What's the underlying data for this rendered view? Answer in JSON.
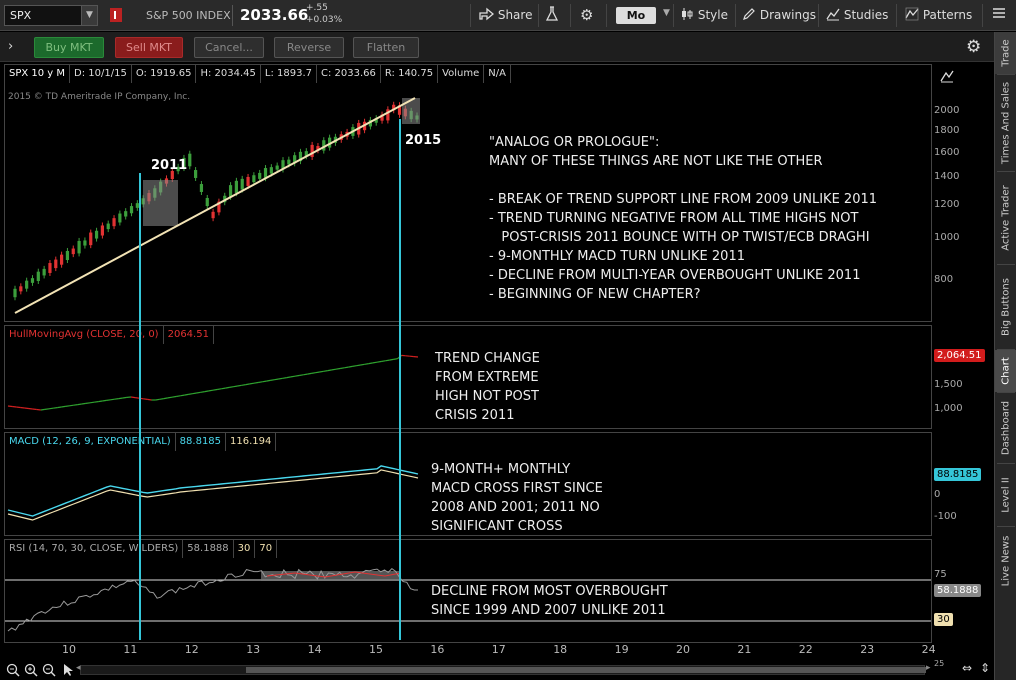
{
  "topbar": {
    "symbol": "SPX",
    "index_name": "S&P 500 INDEX",
    "last_price": "2033.66",
    "change_abs": "+.55",
    "change_pct": "+0.03%",
    "share": "Share",
    "mode": "Mo",
    "style": "Style",
    "drawings": "Drawings",
    "studies": "Studies",
    "patterns": "Patterns"
  },
  "order_bar": {
    "buy": "Buy MKT",
    "sell": "Sell MKT",
    "cancel": "Cancel...",
    "reverse": "Reverse",
    "flatten": "Flatten"
  },
  "side_tabs": [
    "Trade",
    "Times And Sales",
    "Active Trader",
    "Big Buttons",
    "Chart",
    "Dashboard",
    "Level II",
    "Live News"
  ],
  "price_pane": {
    "header": {
      "period": "SPX 10 y M",
      "date": "D: 10/1/15",
      "open": "O: 1919.65",
      "high": "H: 2034.45",
      "low": "L: 1893.7",
      "close": "C: 2033.66",
      "range": "R: 140.75",
      "volume_label": "Volume",
      "volume_value": "N/A"
    },
    "copyright": "2015 © TD Ameritrade IP Company, Inc.",
    "label_2011": "2011",
    "label_2015": "2015",
    "annotation": "\"ANALOG OR PROLOGUE\":\nMANY OF THESE THINGS ARE NOT LIKE THE OTHER\n\n- BREAK OF TREND SUPPORT LINE FROM 2009 UNLIKE 2011\n- TREND TURNING NEGATIVE FROM ALL TIME HIGHS NOT\n   POST-CRISIS 2011 BOUNCE WITH OP TWIST/ECB DRAGHI\n- 9-MONTHLY MACD TURN UNLIKE 2011\n- DECLINE FROM MULTI-YEAR OVERBOUGHT UNLIKE 2011\n- BEGINNING OF NEW CHAPTER?",
    "scale": [
      "2000",
      "1800",
      "1600",
      "1400",
      "1200",
      "1000",
      "800"
    ]
  },
  "hull_pane": {
    "study": "HullMovingAvg (CLOSE, 20, 0)",
    "value": "2064.51",
    "tag": "2,064.51",
    "annotation": "TREND CHANGE\nFROM EXTREME\nHIGH NOT POST\nCRISIS 2011",
    "scale": [
      "2,000",
      "1,500",
      "1,000"
    ]
  },
  "macd_pane": {
    "study": "MACD (12, 26, 9, EXPONENTIAL)",
    "value1": "88.8185",
    "value2": "116.194",
    "tag": "88.8185",
    "annotation": "9-MONTH+ MONTHLY\nMACD CROSS FIRST SINCE\n2008 AND 2001; 2011 NO\nSIGNIFICANT CROSS",
    "scale": [
      "0",
      "-100"
    ]
  },
  "rsi_pane": {
    "study": "RSI (14, 70, 30, CLOSE, WILDERS)",
    "value": "58.1888",
    "ob": "30",
    "os": "70",
    "tag": "58.1888",
    "tag30": "30",
    "annotation": "DECLINE FROM MOST OVERBOUGHT\nSINCE 1999 AND 2007 UNLIKE 2011",
    "scale": [
      "75",
      "50",
      "25"
    ]
  },
  "x_axis": [
    "10",
    "11",
    "12",
    "13",
    "14",
    "15",
    "16",
    "17",
    "18",
    "19",
    "20",
    "21",
    "22",
    "23",
    "24"
  ],
  "colors": {
    "up": "#3c9f3c",
    "down": "#e23232",
    "trendline": "#f2e3b5",
    "vline": "#35c6d8",
    "hull_up": "#2fa32f",
    "hull_down": "#d22020",
    "macd": "#4ad8ee",
    "signal": "#f0e0b0",
    "rsi": "#9a9a9a",
    "tag_red": "#d21c1c",
    "tag_cyan": "#35c6d8"
  }
}
